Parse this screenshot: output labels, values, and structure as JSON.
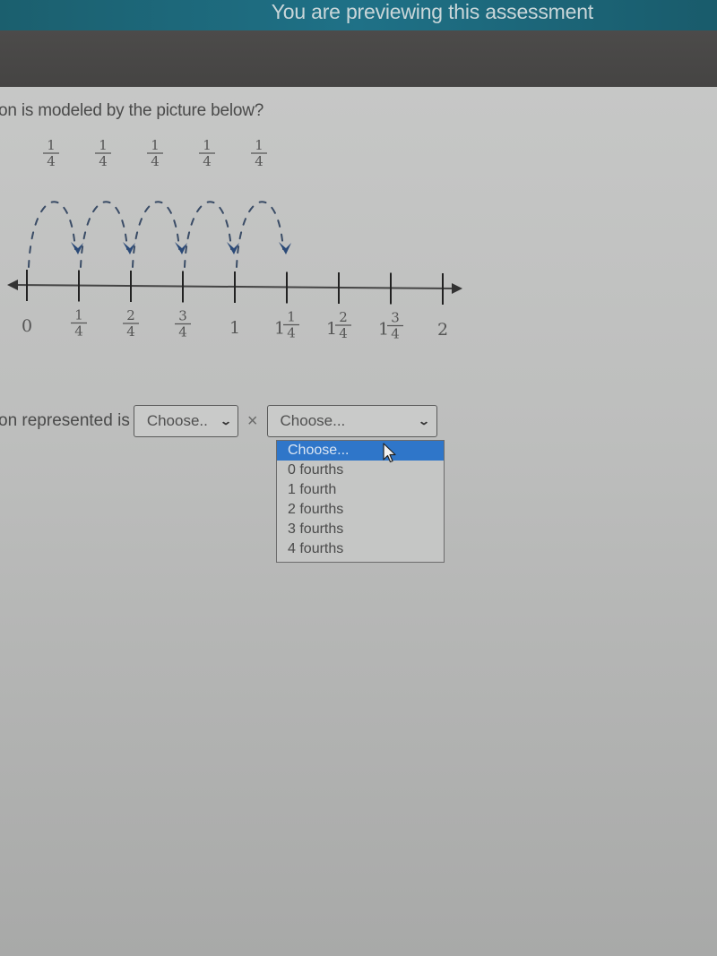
{
  "banner": {
    "text": "You are previewing this assessment"
  },
  "question": {
    "text": "on is modeled by the picture below?"
  },
  "number_line": {
    "hop_labels": [
      {
        "num": "1",
        "den": "4"
      },
      {
        "num": "1",
        "den": "4"
      },
      {
        "num": "1",
        "den": "4"
      },
      {
        "num": "1",
        "den": "4"
      },
      {
        "num": "1",
        "den": "4"
      }
    ],
    "hop_count": 5,
    "hop_size": 0.25,
    "range": [
      0,
      2
    ],
    "tick_step": 0.25,
    "tick_labels": [
      {
        "whole": "0",
        "num": "",
        "den": ""
      },
      {
        "whole": "",
        "num": "1",
        "den": "4"
      },
      {
        "whole": "",
        "num": "2",
        "den": "4"
      },
      {
        "whole": "",
        "num": "3",
        "den": "4"
      },
      {
        "whole": "1",
        "num": "",
        "den": ""
      },
      {
        "whole": "1",
        "num": "1",
        "den": "4"
      },
      {
        "whole": "1",
        "num": "2",
        "den": "4"
      },
      {
        "whole": "1",
        "num": "3",
        "den": "4"
      },
      {
        "whole": "2",
        "num": "",
        "den": ""
      }
    ],
    "arc_color": "#2b4a78"
  },
  "answer": {
    "label": "on represented is",
    "first_select": {
      "value": "Choose.."
    },
    "operator": "×",
    "second_select": {
      "value": "Choose...",
      "options": [
        "Choose...",
        "0 fourths",
        "1 fourth",
        "2 fourths",
        "3 fourths",
        "4 fourths"
      ],
      "highlighted_index": 0
    }
  },
  "colors": {
    "banner": "#1f7187",
    "highlight": "#2f76c9"
  }
}
